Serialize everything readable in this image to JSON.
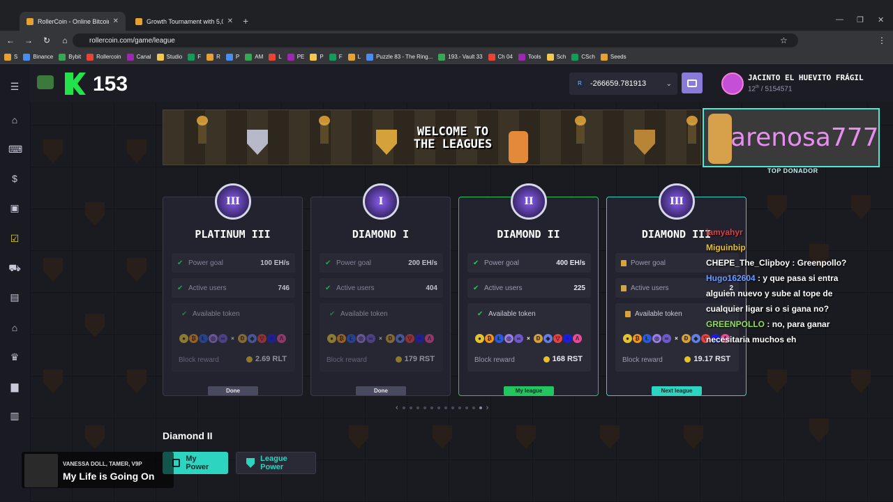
{
  "browser": {
    "tabs": [
      {
        "title": "RollerCoin - Online Bitcoin Mini",
        "active": true
      },
      {
        "title": "Growth Tournament with 5,000",
        "active": false
      }
    ],
    "url": "rollercoin.com/game/league",
    "bookmarks": [
      "S",
      "Binance",
      "Bybit",
      "Rollercoin",
      "Canal",
      "Studio",
      "F",
      "R",
      "P",
      "AM",
      "L",
      "PE",
      "P",
      "F",
      "L",
      "Puzzle 83 - The Ring...",
      "193.- Vault 33",
      "Ch 04",
      "Tools",
      "Sch",
      "CSch",
      "Seeds"
    ]
  },
  "header": {
    "level": "153",
    "balance": "-266659.781913",
    "user_name": "JACINTO EL HUEVITO FRÁGIL",
    "rank": "12",
    "rank_suffix": "th",
    "rank_total": "/ 5154571"
  },
  "banner": {
    "title_line1": "WELCOME TO",
    "title_line2": "THE LEAGUES"
  },
  "donor": {
    "name": "arenosa777",
    "label": "TOP DONADOR"
  },
  "cards": [
    {
      "title": "PLATINUM III",
      "badge": "III",
      "power_label": "Power goal",
      "power": "100 EH/s",
      "users_label": "Active users",
      "users": "746",
      "token_label": "Available token",
      "reward_label": "Block reward",
      "reward": "2.69 RLT",
      "status": "Done"
    },
    {
      "title": "DIAMOND I",
      "badge": "I",
      "power_label": "Power goal",
      "power": "200 EH/s",
      "users_label": "Active users",
      "users": "404",
      "token_label": "Available token",
      "reward_label": "Block reward",
      "reward": "179 RST",
      "status": "Done"
    },
    {
      "title": "DIAMOND II",
      "badge": "II",
      "power_label": "Power goal",
      "power": "400 EH/s",
      "users_label": "Active users",
      "users": "225",
      "token_label": "Available token",
      "reward_label": "Block reward",
      "reward": "168 RST",
      "status": "My league"
    },
    {
      "title": "DIAMOND III",
      "badge": "III",
      "power_label": "Power goal",
      "power": "",
      "users_label": "Active users",
      "users": "2",
      "token_label": "Available token",
      "reward_label": "Block reward",
      "reward": "19.17 RST",
      "status": "Next league"
    }
  ],
  "chat": [
    {
      "user": "iamyahyr",
      "text": ""
    },
    {
      "user": "Miguinbip",
      "text": ""
    },
    {
      "user": "CHEPE_The_Clipboy",
      "text": ": Greenpollo?"
    },
    {
      "user": "Hugo162604",
      "text": ": y que pasa si entra"
    },
    {
      "user": "",
      "text": "alguien nuevo y sube al tope de"
    },
    {
      "user": "",
      "text": "cualquier ligar si o si gana no?"
    },
    {
      "user": "GREENPOLLO",
      "text": ": no, para ganar"
    },
    {
      "user": "",
      "text": "necesitaria muchos eh"
    }
  ],
  "league": {
    "name": "Diamond II",
    "tab_power": "My Power",
    "tab_league": "League Power"
  },
  "stream": {
    "artist": "VANESSA DOLL, TAMER, V9P",
    "song": "My Life is Going On"
  }
}
